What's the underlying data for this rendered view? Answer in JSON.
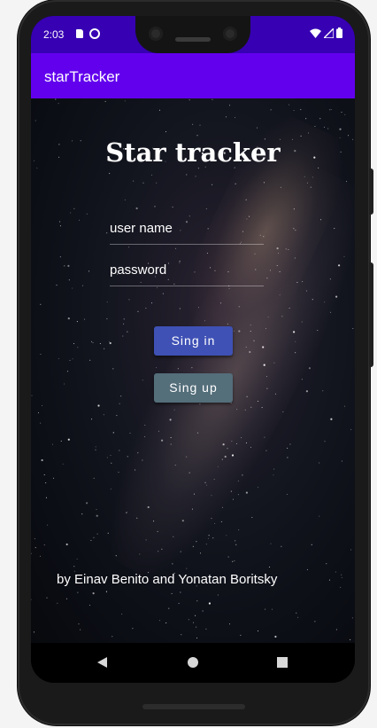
{
  "status_bar": {
    "time": "2:03",
    "icons": [
      "sd-card-icon",
      "sync-icon",
      "wifi-icon",
      "signal-icon",
      "battery-icon"
    ],
    "color": "#3700b3"
  },
  "app_bar": {
    "title": "starTracker",
    "color": "#6200ee"
  },
  "main": {
    "headline": "Star tracker",
    "username_field": {
      "placeholder": "user name",
      "value": ""
    },
    "password_field": {
      "placeholder": "password",
      "value": ""
    },
    "signin_button": {
      "label": "Sing in",
      "color": "#3f51b5"
    },
    "signup_button": {
      "label": "Sing up",
      "color": "#546e7a"
    },
    "credits": "by Einav Benito and Yonatan Boritsky"
  },
  "nav_bar": {
    "items": [
      "back-icon",
      "home-icon",
      "recents-icon"
    ]
  }
}
